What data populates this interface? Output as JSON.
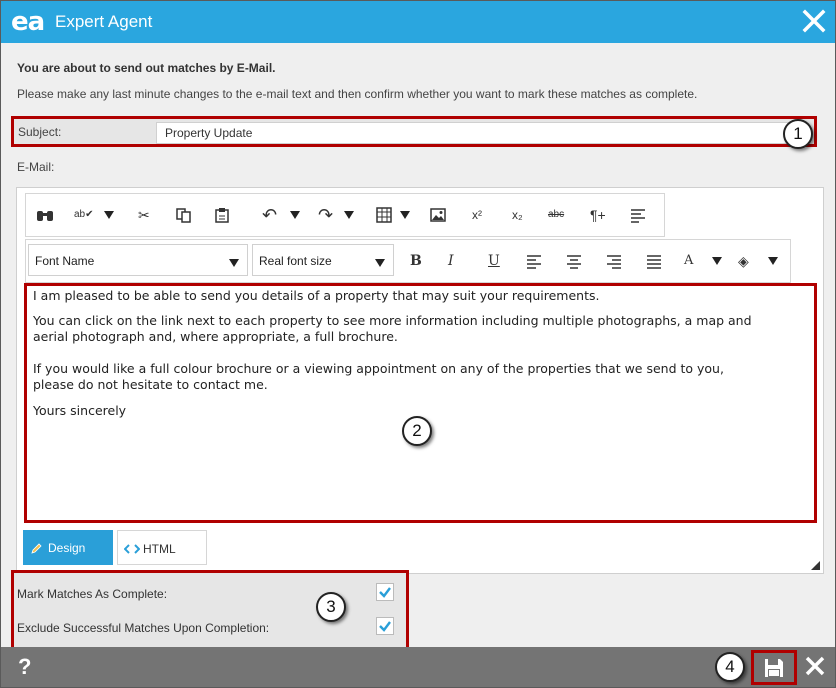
{
  "window": {
    "logo": "ea",
    "title": "Expert Agent"
  },
  "intro": {
    "heading": "You are about to send out matches by E-Mail.",
    "text": "Please make any last minute changes to the e-mail text and then confirm whether you want to mark these matches as complete."
  },
  "subject": {
    "label": "Subject:",
    "value": "Property Update"
  },
  "email": {
    "label": "E-Mail:",
    "font_name": "Font Name",
    "font_size": "Real font size",
    "paragraphs": [
      "I am pleased to be able to send you details of a property that may suit your requirements.",
      "You can click on the link next to each property to see more information including multiple photographs, a map and",
      "aerial photograph and, where appropriate, a full brochure.",
      "If you would like a full colour brochure or a viewing appointment on any of the properties that we send to you,",
      "please do not hesitate to contact me.",
      "Yours sincerely"
    ],
    "tabs": [
      "Design",
      "HTML"
    ]
  },
  "options": {
    "mark_complete_label": "Mark Matches As Complete:",
    "mark_complete_checked": true,
    "exclude_label": "Exclude Successful Matches Upon Completion:",
    "exclude_checked": true
  },
  "footer": {
    "help": "?"
  },
  "callouts": [
    "1",
    "2",
    "3",
    "4"
  ],
  "colors": {
    "titlebar": "#2aa6df",
    "highlight": "#b00000",
    "footer": "#747474",
    "accent": "#2a9fd8"
  }
}
